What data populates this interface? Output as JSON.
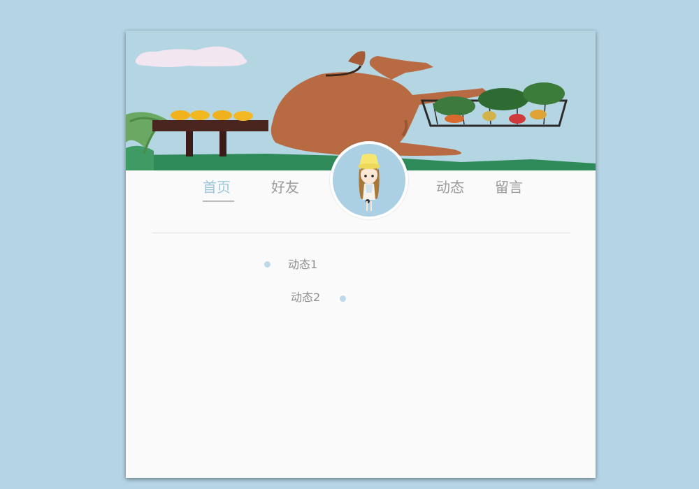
{
  "banner": {
    "description_icon": "dog-photo"
  },
  "nav": {
    "items": [
      {
        "label": "首页",
        "active": true
      },
      {
        "label": "好友",
        "active": false
      },
      {
        "label": "动态",
        "active": false
      },
      {
        "label": "留言",
        "active": false
      }
    ]
  },
  "timeline": {
    "items": [
      {
        "label": "动态1"
      },
      {
        "label": "动态2"
      }
    ]
  },
  "colors": {
    "background": "#b5d5e6",
    "accent": "#9cc6dd",
    "dot": "#bcd8ea"
  }
}
